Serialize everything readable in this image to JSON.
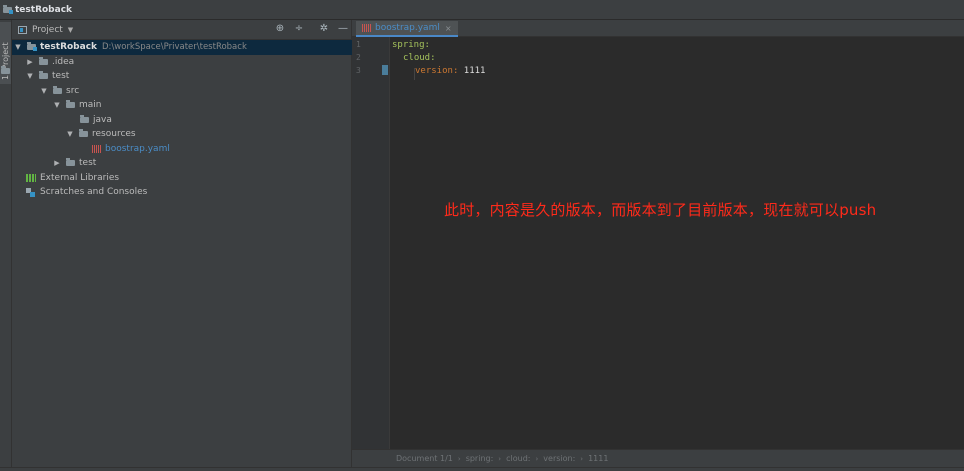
{
  "window": {
    "title": "testRoback"
  },
  "left_strip": {
    "tab_label": "1: Project"
  },
  "project_panel": {
    "title": "Project",
    "tools": [
      "locate-icon",
      "collapse-icon",
      "gear-icon",
      "hide-icon"
    ]
  },
  "tree": [
    {
      "label": "testRoback",
      "path": "D:\\workSpace\\Privater\\testRoback"
    },
    {
      "label": ".idea"
    },
    {
      "label": "test"
    },
    {
      "label": "src"
    },
    {
      "label": "main"
    },
    {
      "label": "java"
    },
    {
      "label": "resources"
    },
    {
      "label": "boostrap.yaml"
    },
    {
      "label": "test"
    },
    {
      "label": "External Libraries"
    },
    {
      "label": "Scratches and Consoles"
    }
  ],
  "editor": {
    "tab": {
      "label": "boostrap.yaml",
      "close": "×"
    },
    "line_numbers": [
      "1",
      "2",
      "3"
    ],
    "lines": [
      {
        "key": "spring",
        "colon": ":",
        "value": ""
      },
      {
        "key": "cloud",
        "colon": ":",
        "value": ""
      },
      {
        "key": "version",
        "colon": ":",
        "value": " 1111"
      }
    ]
  },
  "annotation": "此时，内容是久的版本，而版本到了目前版本，现在就可以push",
  "breadcrumb": {
    "items": [
      "Document 1/1",
      "spring:",
      "cloud:",
      "version:",
      "1111"
    ],
    "separator": "›"
  },
  "colors": {
    "background": "#2b2b2b",
    "panel": "#3c3f41",
    "selection": "#0d293e",
    "yaml_key": "#cc7832",
    "annotation": "#ff2a1a",
    "file_link": "#4b8dc7"
  }
}
